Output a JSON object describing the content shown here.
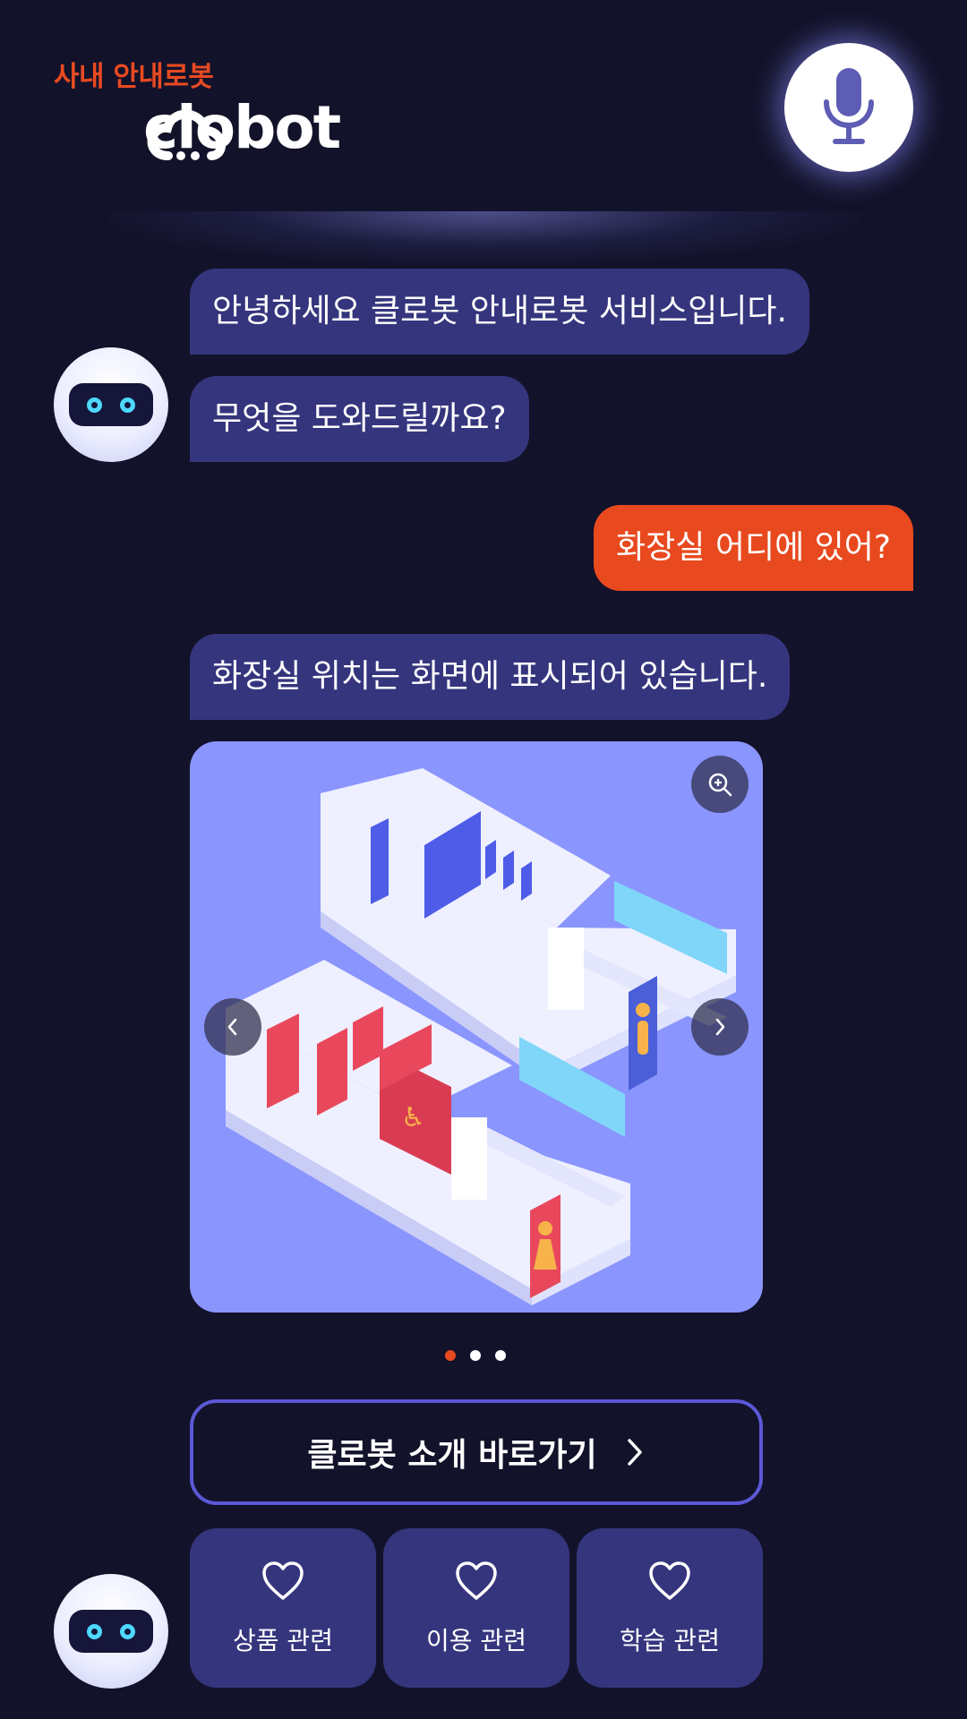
{
  "header": {
    "app_title": "사내 안내로봇",
    "brand": "clobot",
    "mic_icon": "microphone-icon"
  },
  "chat": {
    "greeting_1": "안녕하세요 클로봇 안내로봇 서비스입니다.",
    "greeting_2": "무엇을 도와드릴까요?",
    "user_message": "화장실 어디에 있어?",
    "answer": "화장실 위치는 화면에 표시되어 있습니다."
  },
  "carousel": {
    "total": 3,
    "active_index": 0,
    "icons": [
      "zoom-in-icon",
      "chevron-left-icon",
      "chevron-right-icon"
    ]
  },
  "link_button": {
    "label": "클로봇 소개 바로가기",
    "icon": "chevron-right-icon"
  },
  "quick_menu": [
    {
      "label": "상품 관련",
      "icon": "heart-icon"
    },
    {
      "label": "이용 관련",
      "icon": "heart-icon"
    },
    {
      "label": "학습 관련",
      "icon": "heart-icon"
    }
  ],
  "colors": {
    "background": "#12122a",
    "bot_bubble": "#35357e",
    "user_bubble": "#e8491e",
    "accent_orange": "#e8491e",
    "card": "#8a95fe",
    "outline": "#5b58d6"
  }
}
